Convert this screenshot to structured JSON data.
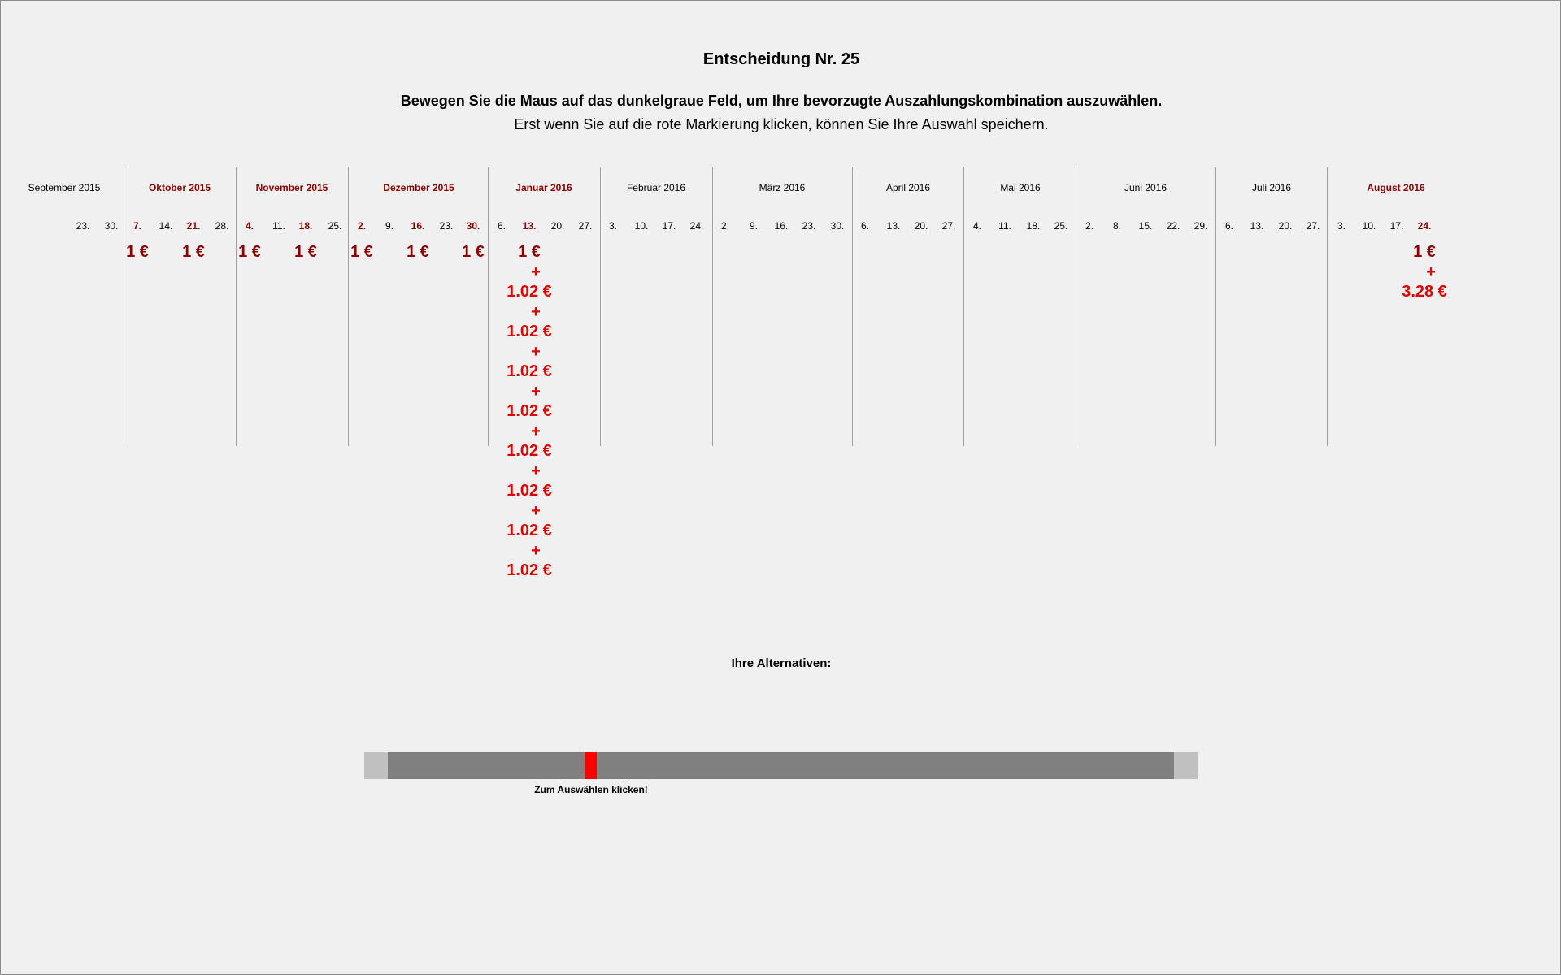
{
  "header": {
    "title": "Entscheidung Nr. 25",
    "instruction": "Bewegen Sie die Maus auf das dunkelgraue Feld, um Ihre bevorzugte Auszahlungskombination auszuwählen.",
    "subinstruction": "Erst wenn Sie auf die rote Markierung klicken, können Sie Ihre Auswahl speichern."
  },
  "calendar": {
    "months": [
      {
        "label": "September 2015",
        "highlighted": false
      },
      {
        "label": "Oktober 2015",
        "highlighted": true
      },
      {
        "label": "November 2015",
        "highlighted": true
      },
      {
        "label": "Dezember 2015",
        "highlighted": true
      },
      {
        "label": "Januar 2016",
        "highlighted": true
      },
      {
        "label": "Februar 2016",
        "highlighted": false
      },
      {
        "label": "März 2016",
        "highlighted": false
      },
      {
        "label": "April 2016",
        "highlighted": false
      },
      {
        "label": "Mai 2016",
        "highlighted": false
      },
      {
        "label": "Juni 2016",
        "highlighted": false
      },
      {
        "label": "Juli 2016",
        "highlighted": false
      },
      {
        "label": "August 2016",
        "highlighted": true
      }
    ],
    "days": [
      {
        "label": "23.",
        "highlighted": false
      },
      {
        "label": "30.",
        "highlighted": false
      },
      {
        "label": "7.",
        "highlighted": true
      },
      {
        "label": "14.",
        "highlighted": false
      },
      {
        "label": "21.",
        "highlighted": true
      },
      {
        "label": "28.",
        "highlighted": false
      },
      {
        "label": "4.",
        "highlighted": true
      },
      {
        "label": "11.",
        "highlighted": false
      },
      {
        "label": "18.",
        "highlighted": true
      },
      {
        "label": "25.",
        "highlighted": false
      },
      {
        "label": "2.",
        "highlighted": true
      },
      {
        "label": "9.",
        "highlighted": false
      },
      {
        "label": "16.",
        "highlighted": true
      },
      {
        "label": "23.",
        "highlighted": false
      },
      {
        "label": "30.",
        "highlighted": true
      },
      {
        "label": "6.",
        "highlighted": false
      },
      {
        "label": "13.",
        "highlighted": true
      },
      {
        "label": "20.",
        "highlighted": false
      },
      {
        "label": "27.",
        "highlighted": false
      },
      {
        "label": "3.",
        "highlighted": false
      },
      {
        "label": "10.",
        "highlighted": false
      },
      {
        "label": "17.",
        "highlighted": false
      },
      {
        "label": "24.",
        "highlighted": false
      },
      {
        "label": "2.",
        "highlighted": false
      },
      {
        "label": "9.",
        "highlighted": false
      },
      {
        "label": "16.",
        "highlighted": false
      },
      {
        "label": "23.",
        "highlighted": false
      },
      {
        "label": "30.",
        "highlighted": false
      },
      {
        "label": "6.",
        "highlighted": false
      },
      {
        "label": "13.",
        "highlighted": false
      },
      {
        "label": "20.",
        "highlighted": false
      },
      {
        "label": "27.",
        "highlighted": false
      },
      {
        "label": "4.",
        "highlighted": false
      },
      {
        "label": "11.",
        "highlighted": false
      },
      {
        "label": "18.",
        "highlighted": false
      },
      {
        "label": "25.",
        "highlighted": false
      },
      {
        "label": "2.",
        "highlighted": false
      },
      {
        "label": "8.",
        "highlighted": false
      },
      {
        "label": "15.",
        "highlighted": false
      },
      {
        "label": "22.",
        "highlighted": false
      },
      {
        "label": "29.",
        "highlighted": false
      },
      {
        "label": "6.",
        "highlighted": false
      },
      {
        "label": "13.",
        "highlighted": false
      },
      {
        "label": "20.",
        "highlighted": false
      },
      {
        "label": "27.",
        "highlighted": false
      },
      {
        "label": "3.",
        "highlighted": false
      },
      {
        "label": "10.",
        "highlighted": false
      },
      {
        "label": "17.",
        "highlighted": false
      },
      {
        "label": "24.",
        "highlighted": true
      }
    ]
  },
  "payments": {
    "weekly_amount": "1 €",
    "plus": "+",
    "bonus_amount": "1.02 €",
    "final_base": "1 €",
    "final_bonus": "3.28 €"
  },
  "alternatives": {
    "label": "Ihre Alternativen:",
    "hint": "Zum Auswählen klicken!",
    "selected_fraction": 0.25
  },
  "colors": {
    "background": "#f0f0f0",
    "highlight_dark_red": "#8b0000",
    "payment_red": "#e00000",
    "slider_dark": "#808080",
    "slider_light": "#c0c0c0",
    "marker": "#ff0000"
  }
}
